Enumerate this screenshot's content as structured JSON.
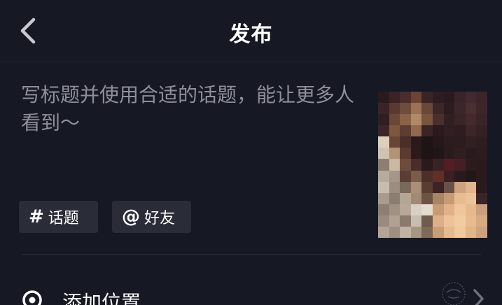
{
  "header": {
    "title": "发布"
  },
  "caption": {
    "placeholder": "写标题并使用合适的话题，能让更多人看到～"
  },
  "chips": [
    {
      "icon": "#",
      "label": "话题"
    },
    {
      "icon": "@",
      "label": "好友"
    }
  ],
  "location": {
    "label": "添加位置"
  },
  "colors": {
    "background": "#161824",
    "chip_background": "#2a2c38",
    "placeholder_text": "#8e8f98",
    "text": "#ffffff"
  },
  "icons": {
    "back": "chevron-left-icon",
    "location": "location-pin-icon",
    "more": "chevron-right-icon"
  }
}
